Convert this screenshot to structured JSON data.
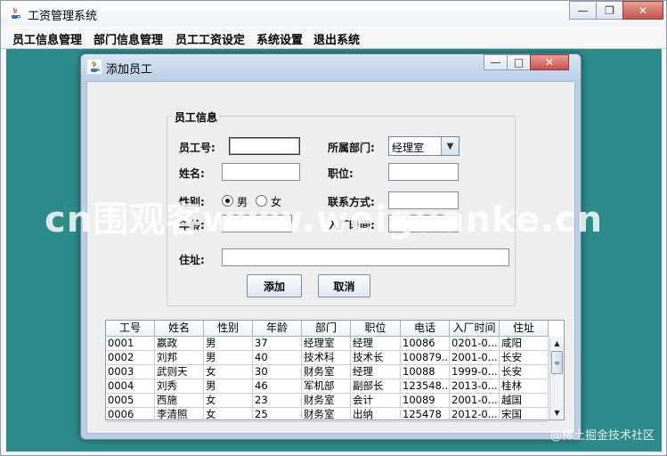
{
  "main_window": {
    "title": "工资管理系统",
    "menu": [
      "员工信息管理",
      "部门信息管理",
      "员工工资设定",
      "系统设置",
      "退出系统"
    ]
  },
  "dialog": {
    "title": "添加员工",
    "group_title": "员工信息",
    "fields": {
      "emp_no_label": "员工号:",
      "emp_no_value": "",
      "dept_label": "所属部门:",
      "dept_value": "经理室",
      "name_label": "姓名:",
      "name_value": "",
      "position_label": "职位:",
      "position_value": "",
      "gender_label": "性别:",
      "gender_male": "男",
      "gender_female": "女",
      "contact_label": "联系方式:",
      "contact_value": "",
      "age_label": "年龄:",
      "age_value": "",
      "hire_label": "入厂时间:",
      "hire_value": "",
      "address_label": "住址:",
      "address_value": ""
    },
    "buttons": {
      "add": "添加",
      "cancel": "取消"
    },
    "table": {
      "columns": [
        "工号",
        "姓名",
        "性别",
        "年龄",
        "部门",
        "职位",
        "电话",
        "入厂时间",
        "住址"
      ],
      "rows": [
        [
          "0001",
          "嬴政",
          "男",
          "37",
          "经理室",
          "经理",
          "10086",
          "0201-0...",
          "咸阳"
        ],
        [
          "0002",
          "刘邦",
          "男",
          "40",
          "技术科",
          "技术长",
          "100879...",
          "2001-0...",
          "长安"
        ],
        [
          "0003",
          "武则天",
          "女",
          "30",
          "财务室",
          "经理",
          "10088",
          "1999-0...",
          "长安"
        ],
        [
          "0004",
          "刘秀",
          "男",
          "46",
          "军机部",
          "副部长",
          "123548...",
          "2013-0...",
          "桂林"
        ],
        [
          "0005",
          "西施",
          "女",
          "23",
          "财务室",
          "会计",
          "10089",
          "2001-0...",
          "越国"
        ],
        [
          "0006",
          "李清照",
          "女",
          "25",
          "财务室",
          "出纳",
          "125478",
          "2012-0...",
          "宋国"
        ]
      ]
    }
  },
  "watermark": "cn围观客www.weiguanke.cn",
  "credit": "@稀土掘金技术社区",
  "colors": {
    "desktop": "#2e8b8b",
    "close_button": "#c75050"
  }
}
